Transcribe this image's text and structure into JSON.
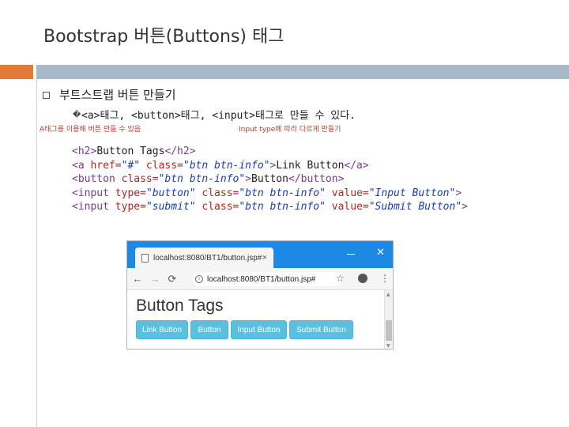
{
  "slide": {
    "title": "Bootstrap 버튼(Buttons) 태그",
    "bullet": "부트스트랩 버튼 만들기",
    "sub_bullet_glyph": "�",
    "sub_bullet": "<a>태그, <button>태그, <input>태그로 만들 수 있다.",
    "note_left": "A태그를 이용해 버튼 만들 수 있음",
    "note_right": "Input type에 따라 다르게 만들기",
    "colors": {
      "accent_orange": "#e07b39",
      "bar_gray": "#a9b7c6",
      "note_red": "#c0392b"
    }
  },
  "code": {
    "l1": {
      "open": "<h2>",
      "text": "Button Tags",
      "close": "</h2>"
    },
    "l2": {
      "a": "<a ",
      "attr1": "href=",
      "val1": "\"#\"",
      "attr2": " class=",
      "val2": "\"btn btn-info\"",
      "gt": ">",
      "text": "Link Button",
      "close": "</a>"
    },
    "l3": {
      "a": "<button ",
      "attr1": "class=",
      "val1": "\"btn btn-info\"",
      "gt": ">",
      "text": "Button",
      "close": "</button>"
    },
    "l4": {
      "a": "<input ",
      "attr1": "type=",
      "val1": "\"button\"",
      "attr2": " class=",
      "val2": "\"btn btn-info\"",
      "attr3": " value=",
      "val3": "\"Input Button\"",
      "gt": ">"
    },
    "l5": {
      "a": "<input ",
      "attr1": "type=",
      "val1": "\"submit\"",
      "attr2": " class=",
      "val2": "\"btn btn-info\"",
      "attr3": " value=",
      "val3": "\"Submit Button\"",
      "gt": ">"
    }
  },
  "browser": {
    "tab_title": "localhost:8080/BT1/button.jsp#",
    "tab_close": "×",
    "window_close": "✕",
    "back": "←",
    "forward": "→",
    "reload": "⟳",
    "info": "i",
    "url": "localhost:8080/BT1/button.jsp#",
    "star": "☆",
    "menu": "⋮",
    "page_heading": "Button Tags",
    "buttons": [
      "Link Button",
      "Button",
      "Input Button",
      "Submit Button"
    ],
    "button_color": "#5bc0de",
    "tab_bar_color": "#1e88e5",
    "scroll_up": "▲",
    "scroll_down": "▼"
  }
}
